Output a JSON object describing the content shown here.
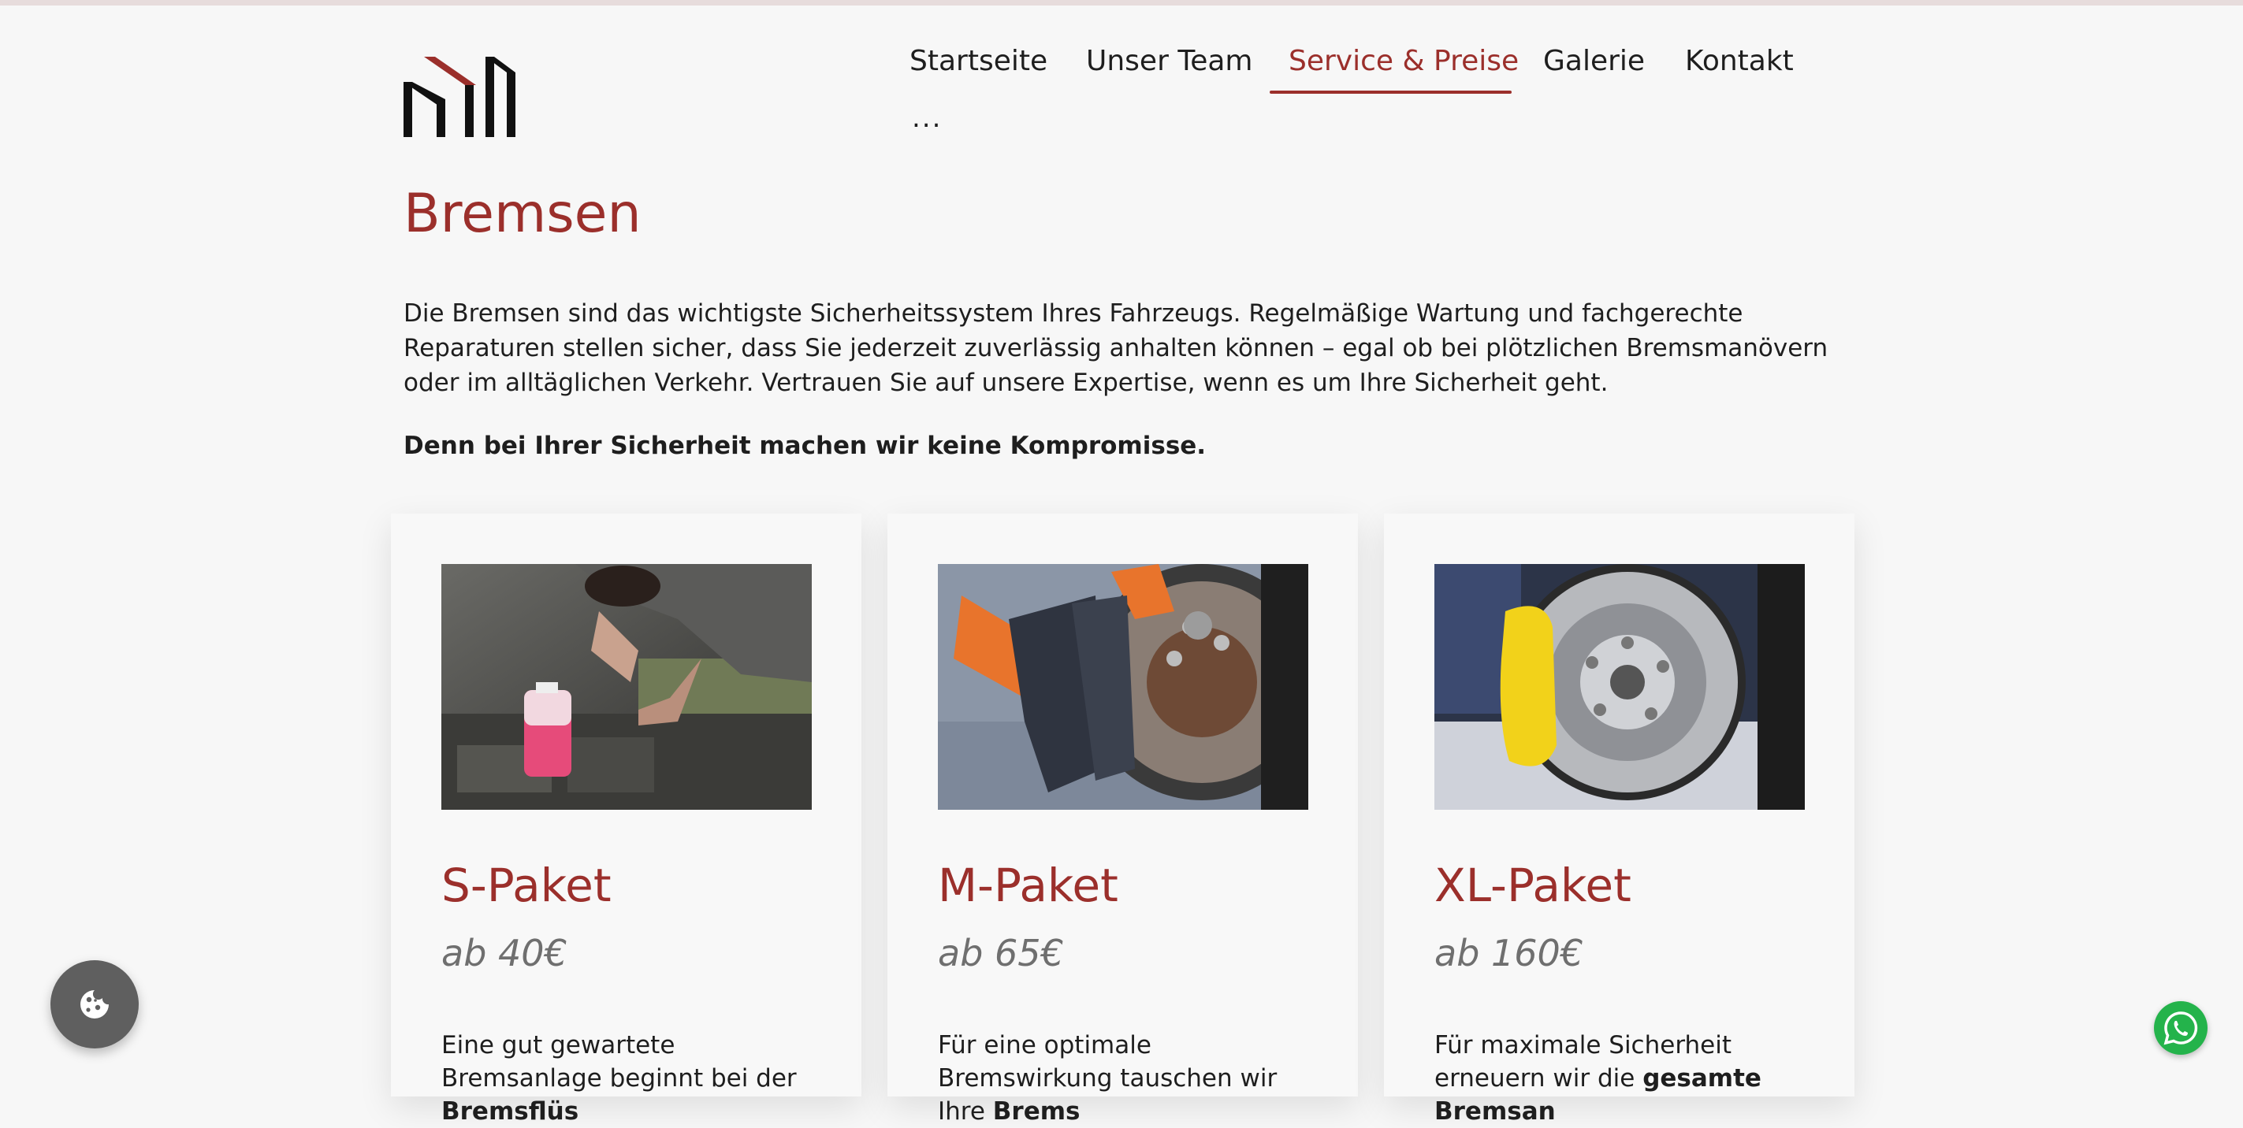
{
  "colors": {
    "accent": "#9b2f2b",
    "text": "#1e1e1e",
    "price": "#6f6f6f",
    "background": "#f7f7f7"
  },
  "nav": {
    "items": [
      "Startseite",
      "Unser Team",
      "Service & Preise",
      "Galerie",
      "Kontakt"
    ],
    "active": "Service & Preise",
    "more": "..."
  },
  "main": {
    "title": "Bremsen",
    "intro": "Die Bremsen sind das wichtigste Sicherheitssystem Ihres Fahrzeugs. Regelmäßige Wartung und fachgerechte Reparaturen stellen sicher, dass Sie jederzeit zuverlässig anhalten können – egal ob bei plötzlichen Bremsmanövern oder im alltäglichen Verkehr. Vertrauen Sie auf unsere Expertise, wenn es um Ihre Sicherheit geht.",
    "emphasis": "Denn bei Ihrer Sicherheit machen wir keine Kompromisse."
  },
  "packages": [
    {
      "title": "S-Paket",
      "price": "ab 40€",
      "desc_lead": "Eine gut gewartete Bremsanlage beginnt bei der ",
      "desc_bold": "Bremsflüs",
      "image": "brake-fluid-photo"
    },
    {
      "title": "M-Paket",
      "price": "ab 65€",
      "desc_lead": "Für eine optimale Bremswirkung tauschen wir Ihre ",
      "desc_bold": "Brems",
      "image": "brake-pads-photo"
    },
    {
      "title": "XL-Paket",
      "price": "ab 160€",
      "desc_lead": "Für maximale Sicherheit erneuern wir die ",
      "desc_bold": "gesamte Bremsan",
      "image": "brake-disc-caliper-photo"
    }
  ],
  "icons": {
    "cookie": "cookie-icon",
    "whatsapp": "whatsapp-icon",
    "logo": "logo-mark"
  }
}
